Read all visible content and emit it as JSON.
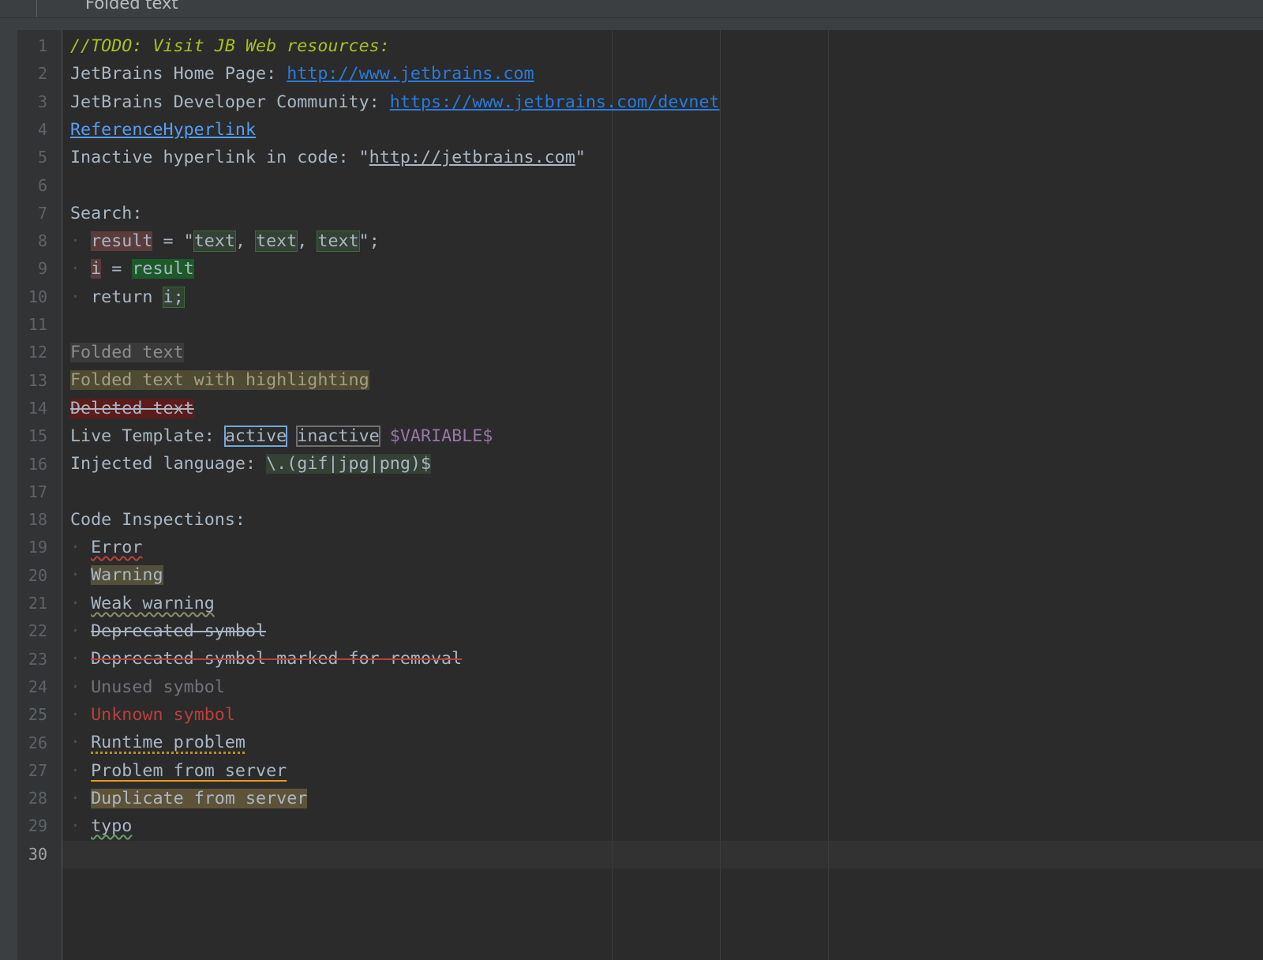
{
  "tab": {
    "label": "Folded text"
  },
  "gutter": {
    "line_numbers": [
      "1",
      "2",
      "3",
      "4",
      "5",
      "6",
      "7",
      "8",
      "9",
      "10",
      "11",
      "12",
      "13",
      "14",
      "15",
      "16",
      "17",
      "18",
      "19",
      "20",
      "21",
      "22",
      "23",
      "24",
      "25",
      "26",
      "27",
      "28",
      "29",
      "30"
    ],
    "current_line": "30"
  },
  "colors": {
    "background": "#2b2b2b",
    "text": "#a9b7c6",
    "todo": "#a8c023",
    "hyperlink": "#287bde",
    "error": "#bc3f3c",
    "template_variable": "#9876aa"
  },
  "code": {
    "l1": {
      "todo": "//TODO: Visit JB Web resources:"
    },
    "l2": {
      "label": "JetBrains Home Page: ",
      "url": "http://www.jetbrains.com"
    },
    "l3": {
      "label": "JetBrains Developer Community: ",
      "url": "https://www.jetbrains.com/devnet"
    },
    "l4": {
      "reference": "ReferenceHyperlink"
    },
    "l5": {
      "label": "Inactive hyperlink in code: \"",
      "url": "http://jetbrains.com",
      "end": "\""
    },
    "l7": {
      "text": "Search:"
    },
    "l8": {
      "result": "result",
      "assign": " = \"",
      "t1": "text",
      "sep1": ", ",
      "t2": "text",
      "sep2": ", ",
      "t3": "text",
      "end": "\";"
    },
    "l9": {
      "i": "i",
      "assign": " = ",
      "result": "result"
    },
    "l10": {
      "ret": "return ",
      "i": "i;"
    },
    "l12": {
      "folded": "Folded text"
    },
    "l13": {
      "folded_hl": "Folded text with highlighting"
    },
    "l14": {
      "deleted": "Deleted text"
    },
    "l15": {
      "label": "Live Template: ",
      "active": "active",
      "inactive": "inactive",
      "variable": "$VARIABLE$"
    },
    "l16": {
      "label": "Injected language: ",
      "regex": "\\.(gif|jpg|png)$"
    },
    "l18": {
      "text": "Code Inspections:"
    },
    "l19": {
      "text": "Error"
    },
    "l20": {
      "text": "Warning"
    },
    "l21": {
      "text": "Weak warning"
    },
    "l22": {
      "text": "Deprecated symbol"
    },
    "l23": {
      "text": "Deprecated symbol marked for removal"
    },
    "l24": {
      "text": "Unused symbol"
    },
    "l25": {
      "text": "Unknown symbol"
    },
    "l26": {
      "text": "Runtime problem"
    },
    "l27": {
      "text": "Problem from server"
    },
    "l28": {
      "text": "Duplicate from server"
    },
    "l29": {
      "text": "typo"
    }
  }
}
